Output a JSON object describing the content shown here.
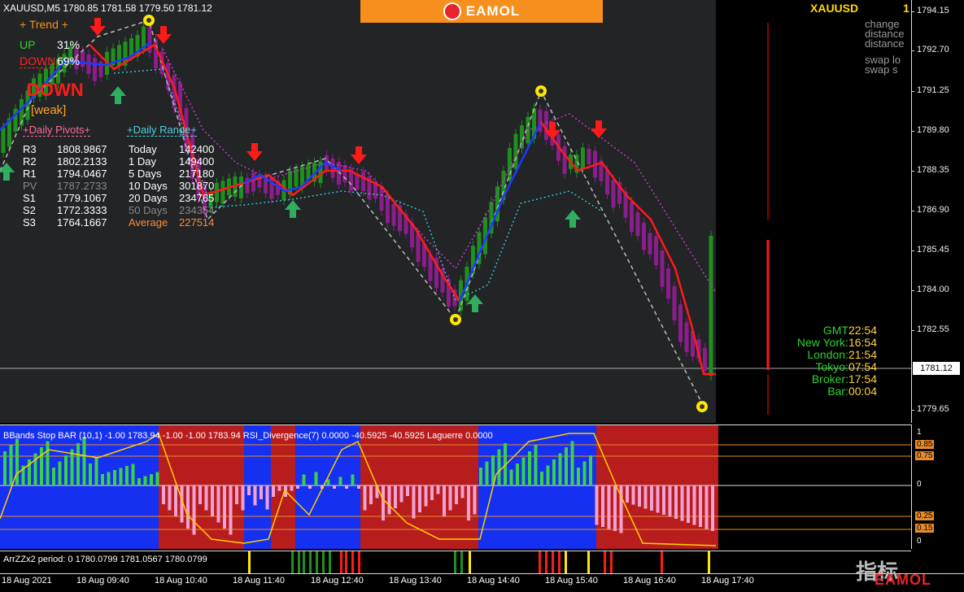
{
  "chart": {
    "header": "XAUUSD,M5  1780.85 1781.58 1779.50 1781.12",
    "symbol": "XAUUSD",
    "symbol_digit": "1",
    "brand": "EAMOL",
    "current_price": "1781.12",
    "price_ticks": [
      "1794.15",
      "1792.70",
      "1791.25",
      "1789.80",
      "1788.35",
      "1786.90",
      "1785.45",
      "1784.00",
      "1782.55",
      "1779.65"
    ],
    "side_info": [
      "change",
      "distance",
      "distance",
      "swap lo",
      "swap s"
    ]
  },
  "trend": {
    "title": "+   Trend   +",
    "up_label": "UP",
    "up_value": "31%",
    "down_label": "DOWN",
    "down_value": "69%",
    "signal": "DOWN",
    "strength": "[weak]"
  },
  "pivots": {
    "title": "+Daily Pivots+",
    "rows": [
      {
        "name": "R3",
        "value": "1808.9867"
      },
      {
        "name": "R2",
        "value": "1802.2133"
      },
      {
        "name": "R1",
        "value": "1794.0467"
      },
      {
        "name": "PV",
        "value": "1787.2733"
      },
      {
        "name": "S1",
        "value": "1779.1067"
      },
      {
        "name": "S2",
        "value": "1772.3333"
      },
      {
        "name": "S3",
        "value": "1764.1667"
      }
    ]
  },
  "daily_range": {
    "title": "+Daily Range+",
    "rows": [
      {
        "name": "Today",
        "value": "142400"
      },
      {
        "name": "1 Day",
        "value": "149400"
      },
      {
        "name": "5 Days",
        "value": "217180"
      },
      {
        "name": "10 Days",
        "value": "301870"
      },
      {
        "name": "20 Days",
        "value": "234765"
      },
      {
        "name": "50 Days",
        "value": "234354"
      },
      {
        "name": "Average",
        "value": "227514"
      }
    ]
  },
  "clocks": [
    {
      "label": "GMT",
      "value": "22:54"
    },
    {
      "label": "New York:",
      "value": "16:54"
    },
    {
      "label": "London:",
      "value": "21:54"
    },
    {
      "label": "Tokyo:",
      "value": "07:54"
    },
    {
      "label": "Broker:",
      "value": "17:54"
    },
    {
      "label": "Bar:",
      "value": "00:04"
    }
  ],
  "sub_indicator": {
    "legend": "BBands Stop BAR (10,1) -1.00 1783.94 -1.00 -1.00 1783.94  RSI_Divergence(7) 0.0000 -40.5925 -40.5925  Laguerre 0.0000",
    "scale": [
      "1",
      "0.85",
      "0.75",
      "0",
      "0.25",
      "0.15",
      "0"
    ]
  },
  "zigzag": {
    "legend": "ArrZZx2 period: 0 1780.0799 1781.0567 1780.0799"
  },
  "time_axis": [
    "18 Aug 2021",
    "18 Aug 09:40",
    "18 Aug 10:40",
    "18 Aug 11:40",
    "18 Aug 12:40",
    "18 Aug 13:40",
    "18 Aug 14:40",
    "18 Aug 15:40",
    "18 Aug 16:40",
    "18 Aug 17:40"
  ],
  "watermark": {
    "cn": "指标",
    "brand": "EAMOL"
  },
  "colors": {
    "bull": "#1f8f1f",
    "bear": "#8a1e8a",
    "ma_red": "#ff1a1a",
    "ma_blue": "#1a3cff",
    "up_arrow": "#2fae5f",
    "down_arrow": "#ff1a1a"
  }
}
